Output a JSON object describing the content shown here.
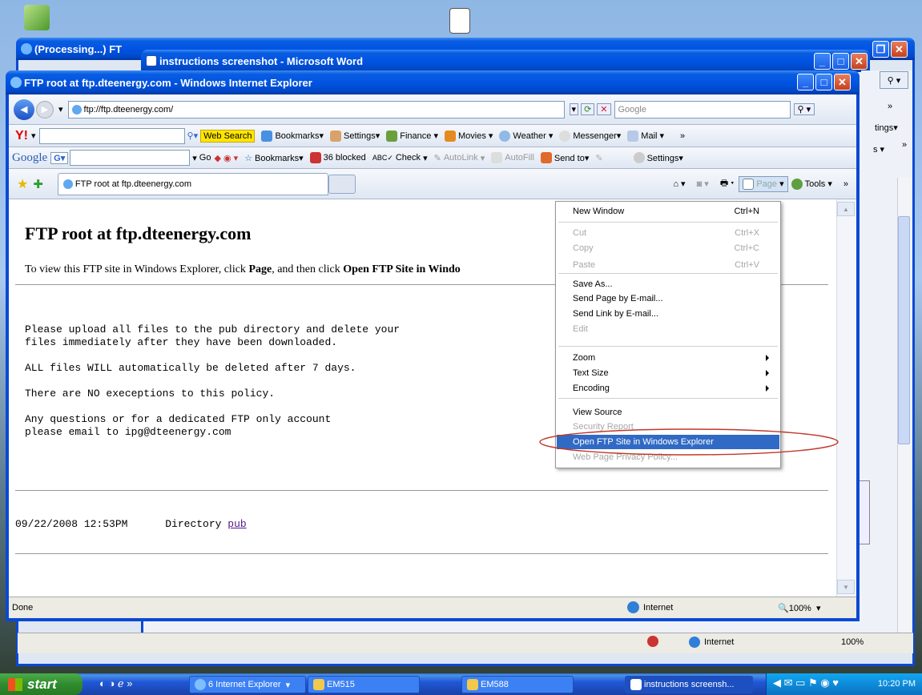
{
  "back_window_1": {
    "title": "(Processing...) FT"
  },
  "back_window_2": {
    "title": "instructions screenshot - Microsoft Word",
    "right_labels": [
      "»",
      "tings▾",
      "s ▾",
      "»"
    ]
  },
  "ie": {
    "title": "FTP root at ftp.dteenergy.com - Windows Internet Explorer",
    "address": "ftp://ftp.dteenergy.com/",
    "search_placeholder": "Google",
    "yahoo_toolbar": {
      "web_search": "Web Search",
      "bookmarks": "Bookmarks▾",
      "settings": "Settings▾",
      "finance": "Finance",
      "movies": "Movies",
      "weather": "Weather",
      "messenger": "Messenger▾",
      "mail": "Mail"
    },
    "google_toolbar": {
      "logo": "Google",
      "go": "Go",
      "bookmarks": "Bookmarks▾",
      "blocked": "36 blocked",
      "check": "Check",
      "autolink": "AutoLink",
      "autofill": "AutoFill",
      "send_to": "Send to▾",
      "settings": "Settings▾"
    },
    "tab_label": "FTP root at ftp.dteenergy.com",
    "command_bar": {
      "page": "Page",
      "tools": "Tools"
    },
    "page": {
      "heading": "FTP root at ftp.dteenergy.com",
      "instruction_prefix": "To view this FTP site in Windows Explorer, click ",
      "instruction_page": "Page",
      "instruction_mid": ", and then click ",
      "instruction_open": "Open FTP Site in Windo",
      "message": "Please upload all files to the pub directory and delete your\nfiles immediately after they have been downloaded.\n\nALL files WILL automatically be deleted after 7 days.\n\nThere are NO execeptions to this policy.\n\nAny questions or for a dedicated FTP only account\nplease email to ipg@dteenergy.com",
      "listing_date": "09/22/2008 12:53PM",
      "listing_type": "Directory",
      "listing_link": "pub"
    },
    "status": {
      "left": "Done",
      "zone": "Internet",
      "zoom": "100%"
    }
  },
  "menu": {
    "items": [
      {
        "label": "New Window",
        "shortcut": "Ctrl+N",
        "disabled": false
      },
      {
        "label": "Cut",
        "shortcut": "Ctrl+X",
        "disabled": true
      },
      {
        "label": "Copy",
        "shortcut": "Ctrl+C",
        "disabled": true
      },
      {
        "label": "Paste",
        "shortcut": "Ctrl+V",
        "disabled": true
      },
      {
        "label": "Save As...",
        "shortcut": "",
        "disabled": false
      },
      {
        "label": "Send Page by E-mail...",
        "shortcut": "",
        "disabled": false
      },
      {
        "label": "Send Link by E-mail...",
        "shortcut": "",
        "disabled": false
      },
      {
        "label": "Edit",
        "shortcut": "",
        "disabled": true
      },
      {
        "label": "Zoom",
        "shortcut": "",
        "disabled": false
      },
      {
        "label": "Text Size",
        "shortcut": "",
        "disabled": false
      },
      {
        "label": "Encoding",
        "shortcut": "",
        "disabled": false
      },
      {
        "label": "View Source",
        "shortcut": "",
        "disabled": false
      },
      {
        "label": "Security Report",
        "shortcut": "",
        "disabled": true
      },
      {
        "label": "Open FTP Site in Windows Explorer",
        "shortcut": "",
        "disabled": false
      },
      {
        "label": "Web Page Privacy Policy...",
        "shortcut": "",
        "disabled": true
      }
    ]
  },
  "outer_status": {
    "zone": "Internet",
    "zoom": "100%"
  },
  "taskbar": {
    "start": "start",
    "ie_group": "6 Internet Explorer",
    "em515": "EM515",
    "em588": "EM588",
    "word": "instructions screensh...",
    "clock": "10:20 PM"
  },
  "colors": {
    "highlight": "#316ac5",
    "title_blue": "#0054e3",
    "annotation": "#c0392b"
  }
}
